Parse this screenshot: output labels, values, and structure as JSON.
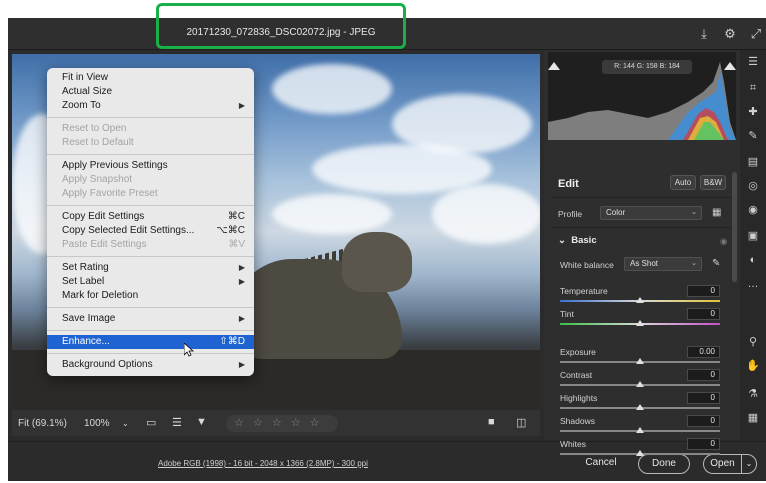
{
  "window": {
    "title": "20171230_072836_DSC02072.jpg  -  JPEG"
  },
  "titlebar_icons": [
    "save-icon",
    "gear-icon",
    "expand-icon"
  ],
  "context_menu": {
    "groups": [
      [
        {
          "label": "Fit in View",
          "shortcut": "",
          "submenu": false,
          "disabled": false
        },
        {
          "label": "Actual Size",
          "shortcut": "",
          "submenu": false,
          "disabled": false
        },
        {
          "label": "Zoom To",
          "shortcut": "",
          "submenu": true,
          "disabled": false
        }
      ],
      [
        {
          "label": "Reset to Open",
          "shortcut": "",
          "submenu": false,
          "disabled": true
        },
        {
          "label": "Reset to Default",
          "shortcut": "",
          "submenu": false,
          "disabled": true
        }
      ],
      [
        {
          "label": "Apply Previous Settings",
          "shortcut": "",
          "submenu": false,
          "disabled": false
        },
        {
          "label": "Apply Snapshot",
          "shortcut": "",
          "submenu": false,
          "disabled": true
        },
        {
          "label": "Apply Favorite Preset",
          "shortcut": "",
          "submenu": false,
          "disabled": true
        }
      ],
      [
        {
          "label": "Copy Edit Settings",
          "shortcut": "⌘C",
          "submenu": false,
          "disabled": false
        },
        {
          "label": "Copy Selected Edit Settings...",
          "shortcut": "⌥⌘C",
          "submenu": false,
          "disabled": false
        },
        {
          "label": "Paste Edit Settings",
          "shortcut": "⌘V",
          "submenu": false,
          "disabled": true
        }
      ],
      [
        {
          "label": "Set Rating",
          "shortcut": "",
          "submenu": true,
          "disabled": false
        },
        {
          "label": "Set Label",
          "shortcut": "",
          "submenu": true,
          "disabled": false
        },
        {
          "label": "Mark for Deletion",
          "shortcut": "",
          "submenu": false,
          "disabled": false
        }
      ],
      [
        {
          "label": "Save Image",
          "shortcut": "",
          "submenu": true,
          "disabled": false
        }
      ],
      [
        {
          "label": "Enhance...",
          "shortcut": "⇧⌘D",
          "submenu": false,
          "disabled": false,
          "active": true
        }
      ],
      [
        {
          "label": "Background Options",
          "shortcut": "",
          "submenu": true,
          "disabled": false
        }
      ]
    ]
  },
  "bottom_toolbar": {
    "zoom_fit": "Fit (69.1%)",
    "zoom_100": "100%",
    "stars": "☆ ☆ ☆ ☆ ☆"
  },
  "footer": {
    "info_link": "Adobe RGB (1998) - 16 bit - 2048 x 1366 (2.8MP) - 300 ppi",
    "cancel": "Cancel",
    "done": "Done",
    "open": "Open"
  },
  "panel": {
    "histogram_readout": "R: 144   G: 158   B: 184",
    "edit_title": "Edit",
    "auto_label": "Auto",
    "bw_label": "B&W",
    "profile_label": "Profile",
    "profile_value": "Color",
    "section_basic": "Basic",
    "white_balance_label": "White balance",
    "white_balance_value": "As Shot",
    "sliders": [
      {
        "label": "Temperature",
        "value": "0",
        "track": "temp"
      },
      {
        "label": "Tint",
        "value": "0",
        "track": "tint"
      },
      {
        "label": "Exposure",
        "value": "0.00",
        "track": "gray"
      },
      {
        "label": "Contrast",
        "value": "0",
        "track": "gray"
      },
      {
        "label": "Highlights",
        "value": "0",
        "track": "gray"
      },
      {
        "label": "Shadows",
        "value": "0",
        "track": "gray"
      },
      {
        "label": "Whites",
        "value": "0",
        "track": "gray"
      }
    ]
  },
  "toolstrip_icons": [
    "sliders-icon",
    "crop-icon",
    "healing-icon",
    "brush-icon",
    "gradient-icon",
    "radial-icon",
    "redeye-icon",
    "snapshots-icon",
    "presets-icon",
    "more-icon",
    "zoom-icon",
    "hand-icon",
    "sampler-icon",
    "grid-icon"
  ]
}
